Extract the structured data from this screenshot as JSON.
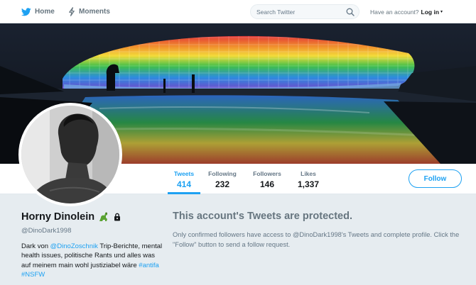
{
  "nav": {
    "home_label": "Home",
    "moments_label": "Moments",
    "home_icon": "twitter-bird-icon",
    "moments_icon": "lightning-icon",
    "search_placeholder": "Search Twitter",
    "search_icon": "search-icon",
    "account_prompt": "Have an account?",
    "login_label": "Log in",
    "login_caret": "▾"
  },
  "profile": {
    "name": "Horny Dinolein",
    "name_emoji_icon": "dinosaur-icon",
    "lock_icon": "lock-icon",
    "handle": "@DinoDark1998",
    "bio": {
      "part1": "Dark von ",
      "mention": "@DinoZoschnik",
      "part2": " Trip-Berichte, mental health issues, politische Rants und alles was auf meinem main wohl justiziabel wäre ",
      "hashtag1": "#antifa",
      "sep": " ",
      "hashtag2": "#NSFW"
    }
  },
  "stats": [
    {
      "label": "Tweets",
      "value": "414",
      "active": true
    },
    {
      "label": "Following",
      "value": "232",
      "active": false
    },
    {
      "label": "Followers",
      "value": "146",
      "active": false
    },
    {
      "label": "Likes",
      "value": "1,337",
      "active": false
    }
  ],
  "follow_label": "Follow",
  "protected": {
    "title": "This account's Tweets are protected.",
    "text": "Only confirmed followers have access to @DinoDark1998's Tweets and complete profile. Click the \"Follow\" button to send a follow request."
  },
  "colors": {
    "accent": "#1da1f2",
    "background": "#e6ecf0",
    "muted": "#657786"
  }
}
